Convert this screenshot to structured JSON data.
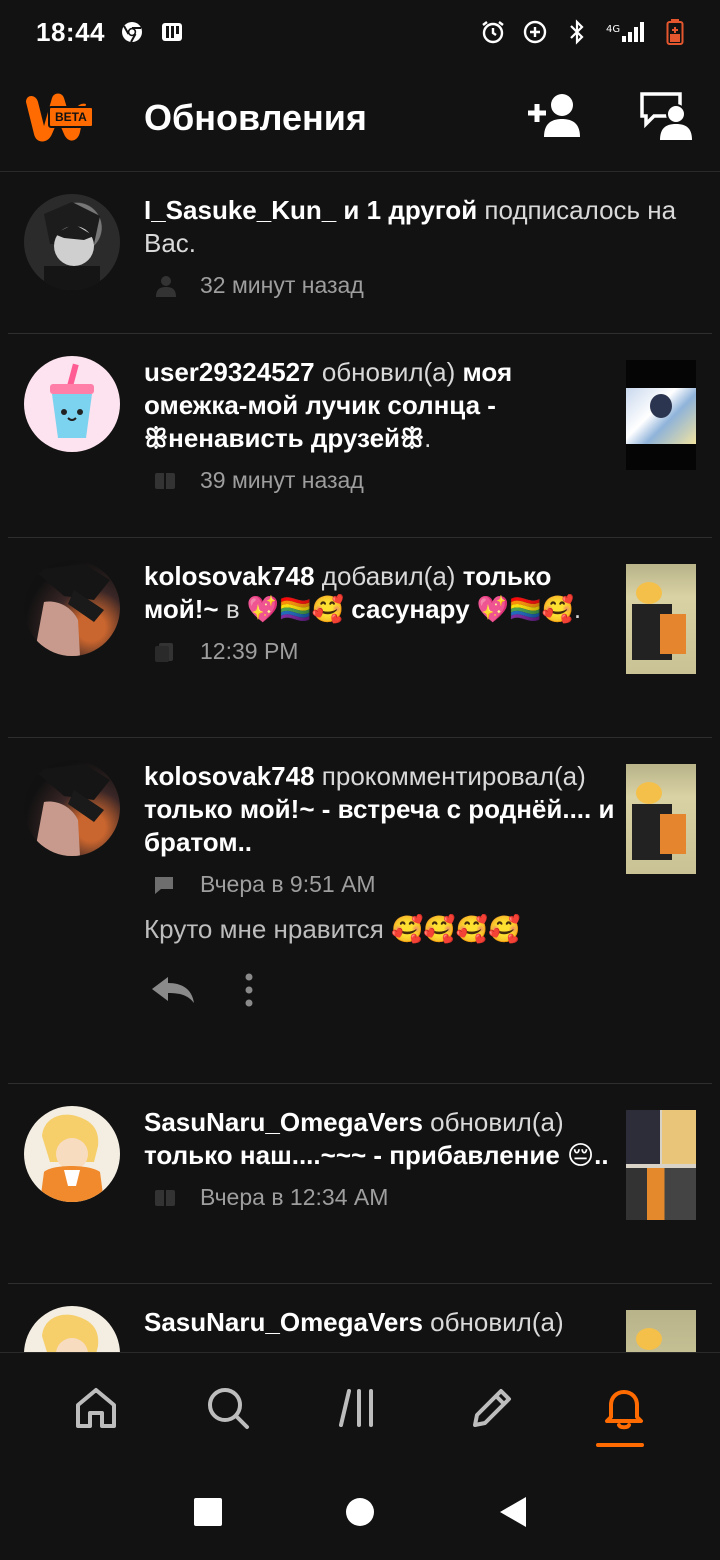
{
  "status_bar": {
    "time": "18:44",
    "left_icons": [
      "chrome-icon",
      "app-icon"
    ],
    "right_icons": [
      "alarm-icon",
      "data-saver-icon",
      "bluetooth-icon",
      "signal-icon",
      "battery-icon"
    ],
    "network": "4G"
  },
  "header": {
    "logo_badge": "BETA",
    "title": "Обновления",
    "actions": [
      "add-user-icon",
      "messages-icon"
    ]
  },
  "feed": [
    {
      "text_html": "<b>I_Sasuke_Kun_ и 1 другой</b> подписалось на Вас.",
      "meta_icon": "user-icon",
      "time": "32 минут назад",
      "has_thumb": false
    },
    {
      "text_html": "<b>user29324527</b> обновил(а) <b>моя омежка-мой лучик солнца - ꕥненависть друзейꕥ</b>.",
      "meta_icon": "book-icon",
      "time": "39 минут назад",
      "has_thumb": true
    },
    {
      "text_html": "<b>kolosovak748</b> добавил(а) <b>только мой!~</b> в <b>💖🏳️‍🌈🥰 сасунару 💖🏳️‍🌈🥰</b>.",
      "meta_icon": "list-icon",
      "time": "12:39 PM",
      "has_thumb": true
    },
    {
      "text_html": "<b>kolosovak748</b> прокомментировал(а) <b>только мой!~ - встреча с роднёй.... и братом..</b>",
      "meta_icon": "comment-icon",
      "time": "Вчера в 9:51 AM",
      "comment": "Круто мне нравится 🥰🥰🥰🥰",
      "has_thumb": true
    },
    {
      "text_html": "<b>SasuNaru_OmegaVers</b> обновил(а) <b>только наш....~~~ - прибавление 😔..</b>",
      "meta_icon": "book-icon",
      "time": "Вчера в 12:34 AM",
      "has_thumb": true
    },
    {
      "text_html": "<b>SasuNaru_OmegaVers</b> обновил(а)",
      "meta_icon": "",
      "time": "",
      "has_thumb": true
    }
  ],
  "bottom_nav": [
    "home-icon",
    "search-icon",
    "library-icon",
    "write-icon",
    "notifications-icon"
  ],
  "accent_color": "#ff6b00"
}
